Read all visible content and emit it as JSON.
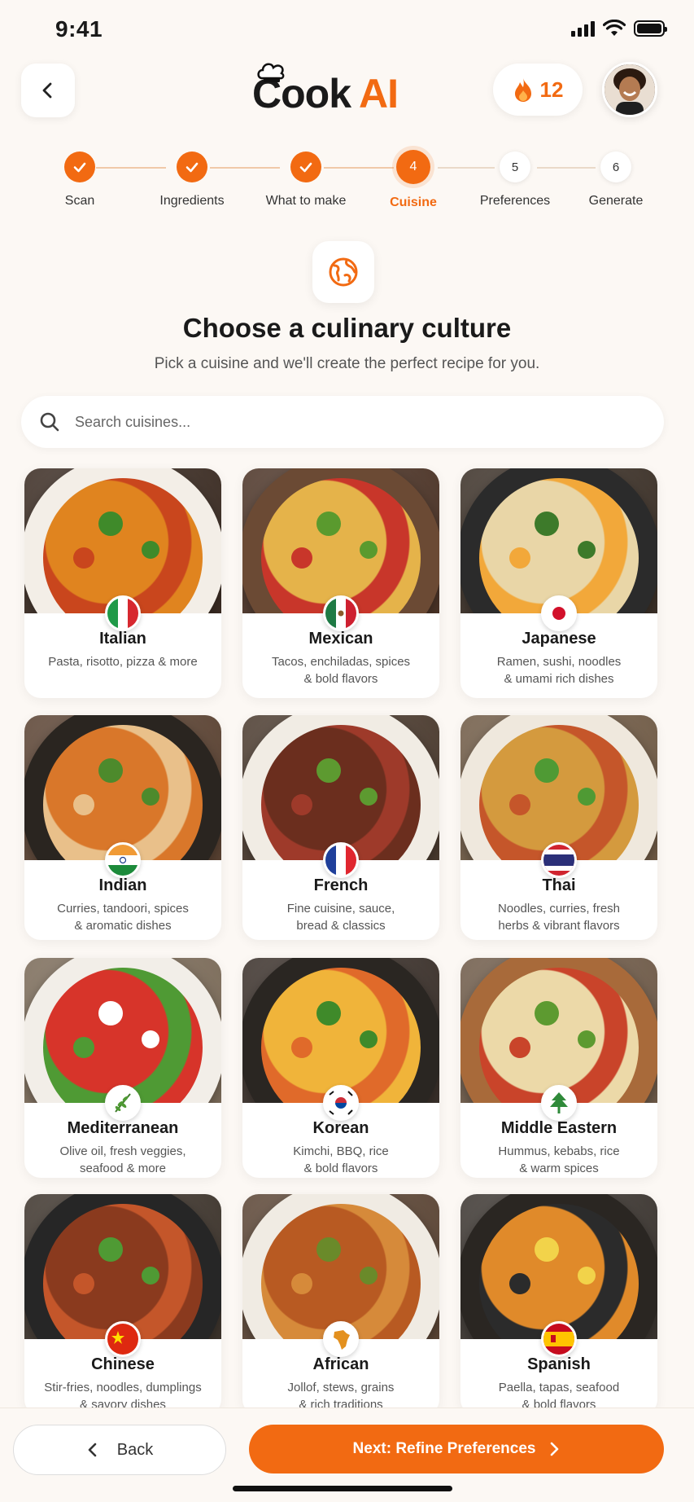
{
  "status_bar": {
    "time": "9:41"
  },
  "header": {
    "logo_main": "Cook",
    "logo_accent": "AI",
    "streak_count": "12",
    "icons": {
      "back": "chevron-left-icon",
      "streak": "flame-icon"
    }
  },
  "stepper": {
    "current_step": 4,
    "steps": [
      {
        "label": "Scan",
        "number": "1",
        "state": "done"
      },
      {
        "label": "Ingredients",
        "number": "2",
        "state": "done"
      },
      {
        "label": "What to make",
        "number": "3",
        "state": "done"
      },
      {
        "label": "Cuisine",
        "number": "4",
        "state": "active"
      },
      {
        "label": "Preferences",
        "number": "5",
        "state": "todo"
      },
      {
        "label": "Generate",
        "number": "6",
        "state": "todo"
      }
    ]
  },
  "main": {
    "title": "Choose a culinary culture",
    "subtitle": "Pick a cuisine and we'll create the perfect recipe for you.",
    "search_placeholder": "Search cuisines..."
  },
  "cuisines": [
    {
      "name": "Italian",
      "desc1": "Pasta, risotto, pizza & more",
      "desc2": "",
      "flag": "italy-flag"
    },
    {
      "name": "Mexican",
      "desc1": "Tacos, enchiladas, spices",
      "desc2": "& bold flavors",
      "flag": "mexico-flag"
    },
    {
      "name": "Japanese",
      "desc1": "Ramen, sushi, noodles",
      "desc2": "& umami rich dishes",
      "flag": "japan-flag"
    },
    {
      "name": "Indian",
      "desc1": "Curries, tandoori, spices",
      "desc2": "& aromatic dishes",
      "flag": "india-flag"
    },
    {
      "name": "French",
      "desc1": "Fine cuisine, sauce,",
      "desc2": "bread & classics",
      "flag": "france-flag"
    },
    {
      "name": "Thai",
      "desc1": "Noodles, curries, fresh",
      "desc2": "herbs & vibrant flavors",
      "flag": "thailand-flag"
    },
    {
      "name": "Mediterranean",
      "desc1": "Olive oil, fresh veggies,",
      "desc2": "seafood & more",
      "flag": "olive-branch-icon"
    },
    {
      "name": "Korean",
      "desc1": "Kimchi, BBQ, rice",
      "desc2": "& bold flavors",
      "flag": "korea-flag"
    },
    {
      "name": "Middle Eastern",
      "desc1": "Hummus, kebabs, rice",
      "desc2": "& warm spices",
      "flag": "cedar-tree-icon"
    },
    {
      "name": "Chinese",
      "desc1": "Stir-fries, noodles, dumplings",
      "desc2": "& savory dishes",
      "flag": "china-flag"
    },
    {
      "name": "African",
      "desc1": "Jollof, stews, grains",
      "desc2": "& rich traditions",
      "flag": "africa-map-icon"
    },
    {
      "name": "Spanish",
      "desc1": "Paella, tapas, seafood",
      "desc2": "& bold flavors",
      "flag": "spain-flag"
    }
  ],
  "footer": {
    "back_label": "Back",
    "next_label": "Next: Refine Preferences"
  },
  "colors": {
    "accent": "#f26a12",
    "background": "#fcf8f4"
  }
}
